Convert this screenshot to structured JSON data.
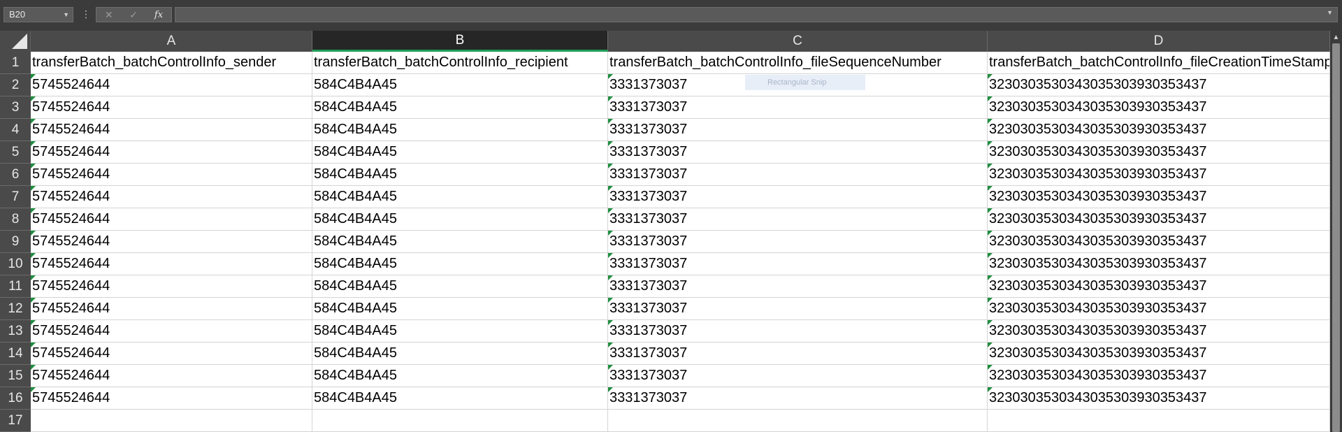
{
  "formula_bar": {
    "name_box": "B20",
    "cancel_icon": "✕",
    "enter_icon": "✓",
    "fx_label": "fx",
    "formula": ""
  },
  "columns": [
    {
      "letter": "A",
      "selected": false
    },
    {
      "letter": "B",
      "selected": true
    },
    {
      "letter": "C",
      "selected": false
    },
    {
      "letter": "D",
      "selected": false
    }
  ],
  "rows": [
    "1",
    "2",
    "3",
    "4",
    "5",
    "6",
    "7",
    "8",
    "9",
    "10",
    "11",
    "12",
    "13",
    "14",
    "15",
    "16",
    "17"
  ],
  "header_row": [
    "transferBatch_batchControlInfo_sender",
    "transferBatch_batchControlInfo_recipient",
    "transferBatch_batchControlInfo_fileSequenceNumber",
    "transferBatch_batchControlInfo_fileCreationTimeStamp"
  ],
  "data_rows": [
    [
      "5745524644",
      "584C4B4A45",
      "3331373037",
      "3230303530343035303930353437"
    ],
    [
      "5745524644",
      "584C4B4A45",
      "3331373037",
      "3230303530343035303930353437"
    ],
    [
      "5745524644",
      "584C4B4A45",
      "3331373037",
      "3230303530343035303930353437"
    ],
    [
      "5745524644",
      "584C4B4A45",
      "3331373037",
      "3230303530343035303930353437"
    ],
    [
      "5745524644",
      "584C4B4A45",
      "3331373037",
      "3230303530343035303930353437"
    ],
    [
      "5745524644",
      "584C4B4A45",
      "3331373037",
      "3230303530343035303930353437"
    ],
    [
      "5745524644",
      "584C4B4A45",
      "3331373037",
      "3230303530343035303930353437"
    ],
    [
      "5745524644",
      "584C4B4A45",
      "3331373037",
      "3230303530343035303930353437"
    ],
    [
      "5745524644",
      "584C4B4A45",
      "3331373037",
      "3230303530343035303930353437"
    ],
    [
      "5745524644",
      "584C4B4A45",
      "3331373037",
      "3230303530343035303930353437"
    ],
    [
      "5745524644",
      "584C4B4A45",
      "3331373037",
      "3230303530343035303930353437"
    ],
    [
      "5745524644",
      "584C4B4A45",
      "3331373037",
      "3230303530343035303930353437"
    ],
    [
      "5745524644",
      "584C4B4A45",
      "3331373037",
      "3230303530343035303930353437"
    ],
    [
      "5745524644",
      "584C4B4A45",
      "3331373037",
      "3230303530343035303930353437"
    ],
    [
      "5745524644",
      "584C4B4A45",
      "3331373037",
      "3230303530343035303930353437"
    ]
  ],
  "text_number_flag_columns": [
    0,
    2,
    3
  ],
  "overlay_tip": "Rectangular Snip",
  "colors": {
    "selected_header_underline": "#1f9e58",
    "error_flag": "#1e8e3e"
  }
}
